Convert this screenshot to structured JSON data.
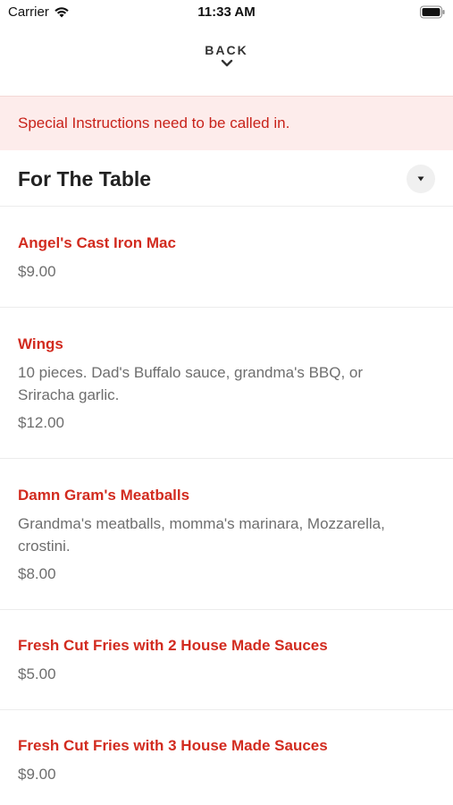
{
  "status_bar": {
    "carrier": "Carrier",
    "time": "11:33 AM"
  },
  "nav": {
    "back_label": "BACK"
  },
  "notice": {
    "text": "Special Instructions need to be called in."
  },
  "section": {
    "title": "For The Table"
  },
  "items": [
    {
      "name": "Angel's Cast Iron Mac",
      "description": "",
      "price": "$9.00"
    },
    {
      "name": "Wings",
      "description": "10 pieces. Dad's Buffalo sauce, grandma's BBQ, or Sriracha garlic.",
      "price": "$12.00"
    },
    {
      "name": "Damn Gram's Meatballs",
      "description": "Grandma's meatballs, momma's marinara, Mozzarella, crostini.",
      "price": "$8.00"
    },
    {
      "name": "Fresh Cut Fries with 2 House Made Sauces",
      "description": "",
      "price": "$5.00"
    },
    {
      "name": "Fresh Cut Fries with 3 House Made Sauces",
      "description": "",
      "price": "$9.00"
    }
  ],
  "colors": {
    "accent": "#d22b1f",
    "notice_bg": "#fdeceb",
    "muted_text": "#6e6e6e"
  }
}
